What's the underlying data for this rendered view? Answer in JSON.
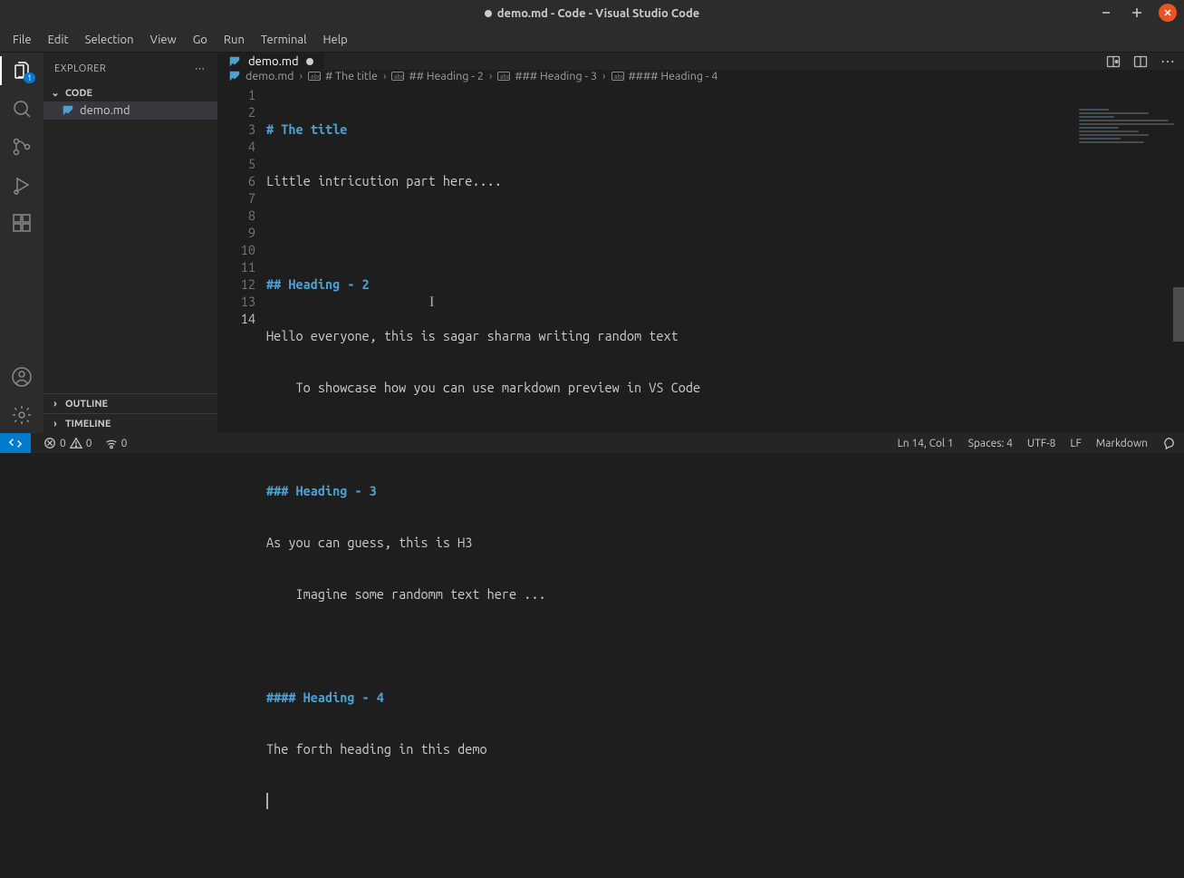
{
  "window": {
    "title": "demo.md - Code - Visual Studio Code"
  },
  "menu": {
    "file": "File",
    "edit": "Edit",
    "selection": "Selection",
    "view": "View",
    "go": "Go",
    "run": "Run",
    "terminal": "Terminal",
    "help": "Help"
  },
  "activity": {
    "explorer_badge": "1"
  },
  "sidebar": {
    "title": "EXPLORER",
    "root": "CODE",
    "file1": "demo.md",
    "outline": "OUTLINE",
    "timeline": "TIMELINE"
  },
  "tabs": {
    "t1": "demo.md"
  },
  "breadcrumbs": {
    "b0": "demo.md",
    "b1": "# The title",
    "b2": "## Heading - 2",
    "b3": "### Heading - 3",
    "b4": "#### Heading - 4"
  },
  "editor": {
    "l1": "# The title",
    "l2": "Little intricution part here....",
    "l3": "",
    "l4": "## Heading - 2",
    "l5": "Hello everyone, this is sagar sharma writing random text",
    "l6": "    To showcase how you can use markdown preview in VS Code",
    "l7": "",
    "l8": "### Heading - 3",
    "l9": "As you can guess, this is H3",
    "l10": "    Imagine some randomm text here ...",
    "l11": "",
    "l12": "#### Heading - 4",
    "l13": "The forth heading in this demo",
    "l14": "",
    "ln1": "1",
    "ln2": "2",
    "ln3": "3",
    "ln4": "4",
    "ln5": "5",
    "ln6": "6",
    "ln7": "7",
    "ln8": "8",
    "ln9": "9",
    "ln10": "10",
    "ln11": "11",
    "ln12": "12",
    "ln13": "13",
    "ln14": "14"
  },
  "status": {
    "errors": "0",
    "warnings": "0",
    "port": "0",
    "cursor": "Ln 14, Col 1",
    "spaces": "Spaces: 4",
    "encoding": "UTF-8",
    "eol": "LF",
    "lang": "Markdown"
  }
}
